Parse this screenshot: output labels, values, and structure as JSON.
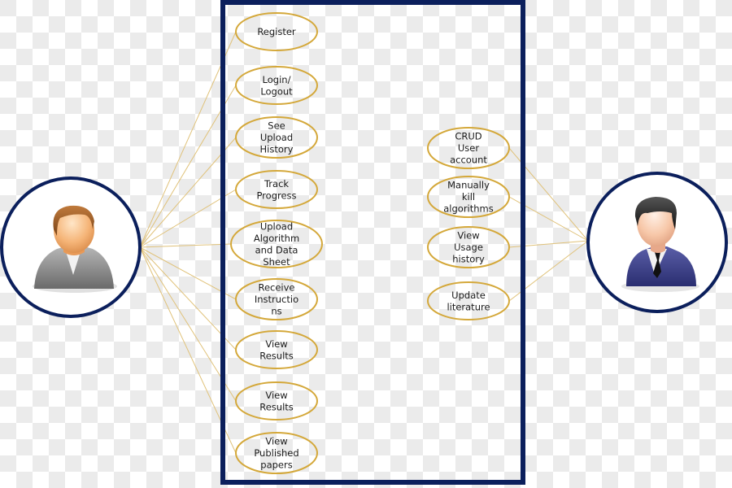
{
  "diagram": {
    "type": "use-case",
    "colors": {
      "system_border": "#0b1f5c",
      "actor_circle": "#0b1f5c",
      "usecase_stroke": "#d4a83a",
      "association_line": "#e0c27a"
    },
    "actors": [
      {
        "id": "user",
        "icon": "user-casual-icon",
        "side": "left"
      },
      {
        "id": "admin",
        "icon": "user-business-icon",
        "side": "right"
      }
    ],
    "left_use_cases": [
      {
        "lines": [
          "Register"
        ]
      },
      {
        "lines": [
          "Login/",
          "Logout"
        ]
      },
      {
        "lines": [
          "See",
          "Upload",
          "History"
        ]
      },
      {
        "lines": [
          "Track",
          "Progress"
        ]
      },
      {
        "lines": [
          "Upload",
          "Algorithm",
          "and Data",
          "Sheet"
        ]
      },
      {
        "lines": [
          "Receive",
          "Instructio",
          "ns"
        ]
      },
      {
        "lines": [
          "View",
          "Results"
        ]
      },
      {
        "lines": [
          "View",
          "Results"
        ]
      },
      {
        "lines": [
          "View",
          "Published",
          "papers"
        ]
      }
    ],
    "right_use_cases": [
      {
        "lines": [
          "CRUD",
          "User",
          "account"
        ]
      },
      {
        "lines": [
          "Manually",
          "kill",
          "algorithms"
        ]
      },
      {
        "lines": [
          "View",
          "Usage",
          "history"
        ]
      },
      {
        "lines": [
          "Update",
          "literature"
        ]
      }
    ]
  }
}
